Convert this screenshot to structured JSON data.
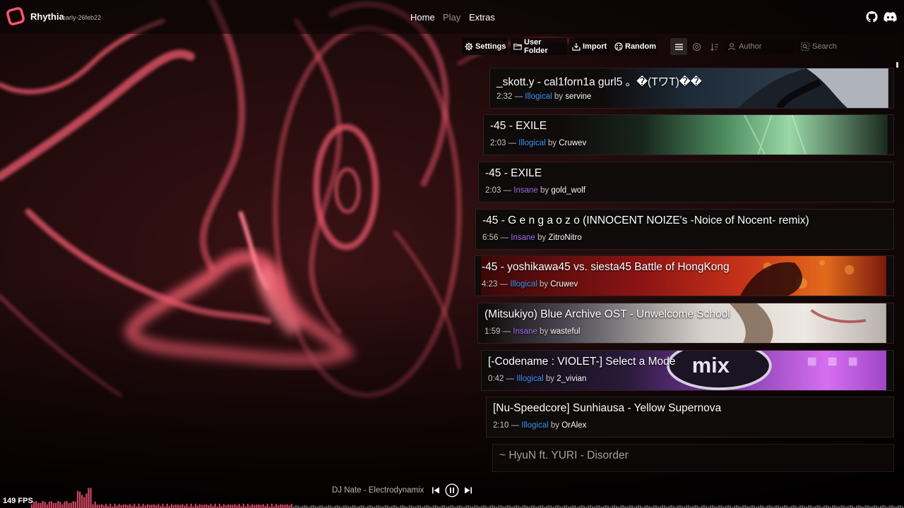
{
  "app": {
    "name": "Rhythia",
    "version": "early-26feb22"
  },
  "nav": {
    "home": "Home",
    "play": "Play",
    "extras": "Extras"
  },
  "toolbar": {
    "settings": "Settings",
    "user_folder": "User Folder",
    "import": "Import",
    "random": "Random",
    "author_placeholder": "Author",
    "search_placeholder": "Search"
  },
  "maps": [
    {
      "title": "_skott.y - cal1forn1a gurl5 。�(TワT)��",
      "duration": "2:32",
      "sep": "—",
      "difficulty": "Illogical",
      "by": "by",
      "mapper": "servine"
    },
    {
      "title": "-45 - EXILE",
      "duration": "2:03",
      "sep": "—",
      "difficulty": "Illogical",
      "by": "by",
      "mapper": "Cruwev"
    },
    {
      "title": "-45 - EXILE",
      "duration": "2:03",
      "sep": "—",
      "difficulty": "Insane",
      "by": "by",
      "mapper": "gold_wolf"
    },
    {
      "title": "-45 - G e n g a o z o (INNOCENT NOIZE's -Noice of Nocent- remix)",
      "duration": "6:56",
      "sep": "—",
      "difficulty": "Insane",
      "by": "by",
      "mapper": "ZitroNitro"
    },
    {
      "title": "-45 - yoshikawa45 vs. siesta45 Battle of HongKong",
      "duration": "4:23",
      "sep": "—",
      "difficulty": "Illogical",
      "by": "by",
      "mapper": "Cruwev"
    },
    {
      "title": "(Mitsukiyo) Blue Archive OST - Unwelcome School",
      "duration": "1:59",
      "sep": "—",
      "difficulty": "Insane",
      "by": "by",
      "mapper": "wasteful"
    },
    {
      "title": "[-Codename : VIOLET-] Select a Mode",
      "duration": "0:42",
      "sep": "—",
      "difficulty": "Illogical",
      "by": "by",
      "mapper": "2_vivian"
    },
    {
      "title": "[Nu-Speedcore] Sunhiausa - Yellow Supernova",
      "duration": "2:10",
      "sep": "—",
      "difficulty": "Illogical",
      "by": "by",
      "mapper": "OrAlex"
    },
    {
      "title": "~ HyuN ft. YURI - Disorder",
      "duration": "",
      "sep": "",
      "difficulty": "",
      "by": "",
      "mapper": ""
    }
  ],
  "footer": {
    "fps": "149 FPS",
    "now_playing": "DJ Nate - Electrodynamix"
  },
  "colors": {
    "accent": "#e84a6a",
    "difficulty_illogical": "#3e95f5",
    "difficulty_insane": "#a56cf0"
  },
  "icons": [
    "logo-icon",
    "github-icon",
    "discord-icon",
    "gear-icon",
    "folder-icon",
    "import-icon",
    "dice-icon",
    "list-view-icon",
    "grid-view-icon",
    "sort-icon",
    "author-icon",
    "search-icon",
    "previous-icon",
    "pause-icon",
    "next-icon"
  ]
}
